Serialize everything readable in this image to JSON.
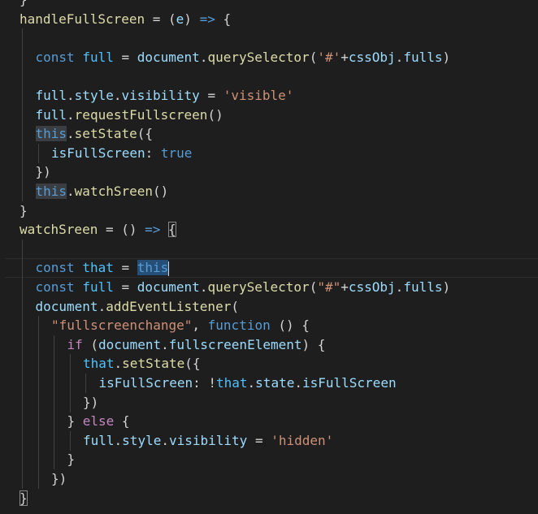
{
  "editor": {
    "colors": {
      "background": "#1e1e1e",
      "plain": "#d4d4d4",
      "keyword": "#569cd6",
      "control": "#c586c0",
      "variable": "#9cdcfe",
      "constant": "#4fc1ff",
      "function": "#dcdcaa",
      "string": "#ce9178"
    },
    "lines": [
      {
        "indent": 0,
        "tokens": [
          {
            "t": "}",
            "c": "tk"
          }
        ]
      },
      {
        "indent": 0,
        "tokens": [
          {
            "t": "handleFullScreen",
            "c": "fn"
          },
          {
            "t": " = (",
            "c": "tk"
          },
          {
            "t": "e",
            "c": "var"
          },
          {
            "t": ") ",
            "c": "tk"
          },
          {
            "t": "=>",
            "c": "kw"
          },
          {
            "t": " {",
            "c": "tk"
          }
        ]
      },
      {
        "indent": 1,
        "tokens": []
      },
      {
        "indent": 1,
        "tokens": [
          {
            "t": "const",
            "c": "kw"
          },
          {
            "t": " ",
            "c": "tk"
          },
          {
            "t": "full",
            "c": "cst"
          },
          {
            "t": " = ",
            "c": "tk"
          },
          {
            "t": "document",
            "c": "var"
          },
          {
            "t": ".",
            "c": "tk"
          },
          {
            "t": "querySelector",
            "c": "fn"
          },
          {
            "t": "(",
            "c": "tk"
          },
          {
            "t": "'#'",
            "c": "str"
          },
          {
            "t": "+",
            "c": "tk"
          },
          {
            "t": "cssObj",
            "c": "var"
          },
          {
            "t": ".",
            "c": "tk"
          },
          {
            "t": "fulls",
            "c": "var"
          },
          {
            "t": ")",
            "c": "tk"
          }
        ]
      },
      {
        "indent": 1,
        "tokens": []
      },
      {
        "indent": 1,
        "tokens": [
          {
            "t": "full",
            "c": "var"
          },
          {
            "t": ".",
            "c": "tk"
          },
          {
            "t": "style",
            "c": "var"
          },
          {
            "t": ".",
            "c": "tk"
          },
          {
            "t": "visibility",
            "c": "var"
          },
          {
            "t": " = ",
            "c": "tk"
          },
          {
            "t": "'visible'",
            "c": "str"
          }
        ]
      },
      {
        "indent": 1,
        "tokens": [
          {
            "t": "full",
            "c": "var"
          },
          {
            "t": ".",
            "c": "tk"
          },
          {
            "t": "requestFullscreen",
            "c": "fn"
          },
          {
            "t": "()",
            "c": "tk"
          }
        ]
      },
      {
        "indent": 1,
        "tokens": [
          {
            "t": "this",
            "c": "kw hl"
          },
          {
            "t": ".",
            "c": "tk"
          },
          {
            "t": "setState",
            "c": "fn"
          },
          {
            "t": "({",
            "c": "tk"
          }
        ]
      },
      {
        "indent": 2,
        "tokens": [
          {
            "t": "isFullScreen",
            "c": "var"
          },
          {
            "t": ": ",
            "c": "tk"
          },
          {
            "t": "true",
            "c": "kw"
          }
        ]
      },
      {
        "indent": 1,
        "tokens": [
          {
            "t": "})",
            "c": "tk"
          }
        ]
      },
      {
        "indent": 1,
        "tokens": [
          {
            "t": "this",
            "c": "kw hl"
          },
          {
            "t": ".",
            "c": "tk"
          },
          {
            "t": "watchSreen",
            "c": "fn"
          },
          {
            "t": "()",
            "c": "tk"
          }
        ]
      },
      {
        "indent": 0,
        "tokens": [
          {
            "t": "}",
            "c": "tk"
          }
        ]
      },
      {
        "indent": 0,
        "tokens": [
          {
            "t": "watchSreen",
            "c": "fn"
          },
          {
            "t": " = () ",
            "c": "tk"
          },
          {
            "t": "=>",
            "c": "kw"
          },
          {
            "t": " ",
            "c": "tk"
          },
          {
            "t": "{",
            "c": "tk brace-match"
          }
        ]
      },
      {
        "indent": 1,
        "tokens": []
      },
      {
        "indent": 1,
        "current": true,
        "tokens": [
          {
            "t": "const",
            "c": "kw"
          },
          {
            "t": " ",
            "c": "tk"
          },
          {
            "t": "that",
            "c": "cst"
          },
          {
            "t": " = ",
            "c": "tk"
          },
          {
            "t": "this",
            "c": "kw hl-this"
          },
          {
            "t": "",
            "c": "caret"
          }
        ]
      },
      {
        "indent": 1,
        "tokens": [
          {
            "t": "const",
            "c": "kw"
          },
          {
            "t": " ",
            "c": "tk"
          },
          {
            "t": "full",
            "c": "cst"
          },
          {
            "t": " = ",
            "c": "tk"
          },
          {
            "t": "document",
            "c": "var"
          },
          {
            "t": ".",
            "c": "tk"
          },
          {
            "t": "querySelector",
            "c": "fn"
          },
          {
            "t": "(",
            "c": "tk"
          },
          {
            "t": "\"#\"",
            "c": "str"
          },
          {
            "t": "+",
            "c": "tk"
          },
          {
            "t": "cssObj",
            "c": "var"
          },
          {
            "t": ".",
            "c": "tk"
          },
          {
            "t": "fulls",
            "c": "var"
          },
          {
            "t": ")",
            "c": "tk"
          }
        ]
      },
      {
        "indent": 1,
        "tokens": [
          {
            "t": "document",
            "c": "var"
          },
          {
            "t": ".",
            "c": "tk"
          },
          {
            "t": "addEventListener",
            "c": "fn"
          },
          {
            "t": "(",
            "c": "tk"
          }
        ]
      },
      {
        "indent": 2,
        "tokens": [
          {
            "t": "\"fullscreenchange\"",
            "c": "str"
          },
          {
            "t": ", ",
            "c": "tk"
          },
          {
            "t": "function",
            "c": "kw"
          },
          {
            "t": " () {",
            "c": "tk"
          }
        ]
      },
      {
        "indent": 3,
        "tokens": [
          {
            "t": "if",
            "c": "ctl"
          },
          {
            "t": " (",
            "c": "tk"
          },
          {
            "t": "document",
            "c": "var"
          },
          {
            "t": ".",
            "c": "tk"
          },
          {
            "t": "fullscreenElement",
            "c": "var"
          },
          {
            "t": ") {",
            "c": "tk"
          }
        ]
      },
      {
        "indent": 4,
        "tokens": [
          {
            "t": "that",
            "c": "cst"
          },
          {
            "t": ".",
            "c": "tk"
          },
          {
            "t": "setState",
            "c": "fn"
          },
          {
            "t": "({",
            "c": "tk"
          }
        ]
      },
      {
        "indent": 5,
        "tokens": [
          {
            "t": "isFullScreen",
            "c": "var"
          },
          {
            "t": ": !",
            "c": "tk"
          },
          {
            "t": "that",
            "c": "cst"
          },
          {
            "t": ".",
            "c": "tk"
          },
          {
            "t": "state",
            "c": "var"
          },
          {
            "t": ".",
            "c": "tk"
          },
          {
            "t": "isFullScreen",
            "c": "var"
          }
        ]
      },
      {
        "indent": 4,
        "tokens": [
          {
            "t": "})",
            "c": "tk"
          }
        ]
      },
      {
        "indent": 3,
        "tokens": [
          {
            "t": "} ",
            "c": "tk"
          },
          {
            "t": "else",
            "c": "ctl"
          },
          {
            "t": " {",
            "c": "tk"
          }
        ]
      },
      {
        "indent": 4,
        "tokens": [
          {
            "t": "full",
            "c": "var"
          },
          {
            "t": ".",
            "c": "tk"
          },
          {
            "t": "style",
            "c": "var"
          },
          {
            "t": ".",
            "c": "tk"
          },
          {
            "t": "visibility",
            "c": "var"
          },
          {
            "t": " = ",
            "c": "tk"
          },
          {
            "t": "'hidden'",
            "c": "str"
          }
        ]
      },
      {
        "indent": 3,
        "tokens": [
          {
            "t": "}",
            "c": "tk"
          }
        ]
      },
      {
        "indent": 2,
        "tokens": [
          {
            "t": "})",
            "c": "tk"
          }
        ]
      },
      {
        "indent": 0,
        "tokens": [
          {
            "t": "}",
            "c": "tk brace-match"
          }
        ]
      }
    ]
  }
}
